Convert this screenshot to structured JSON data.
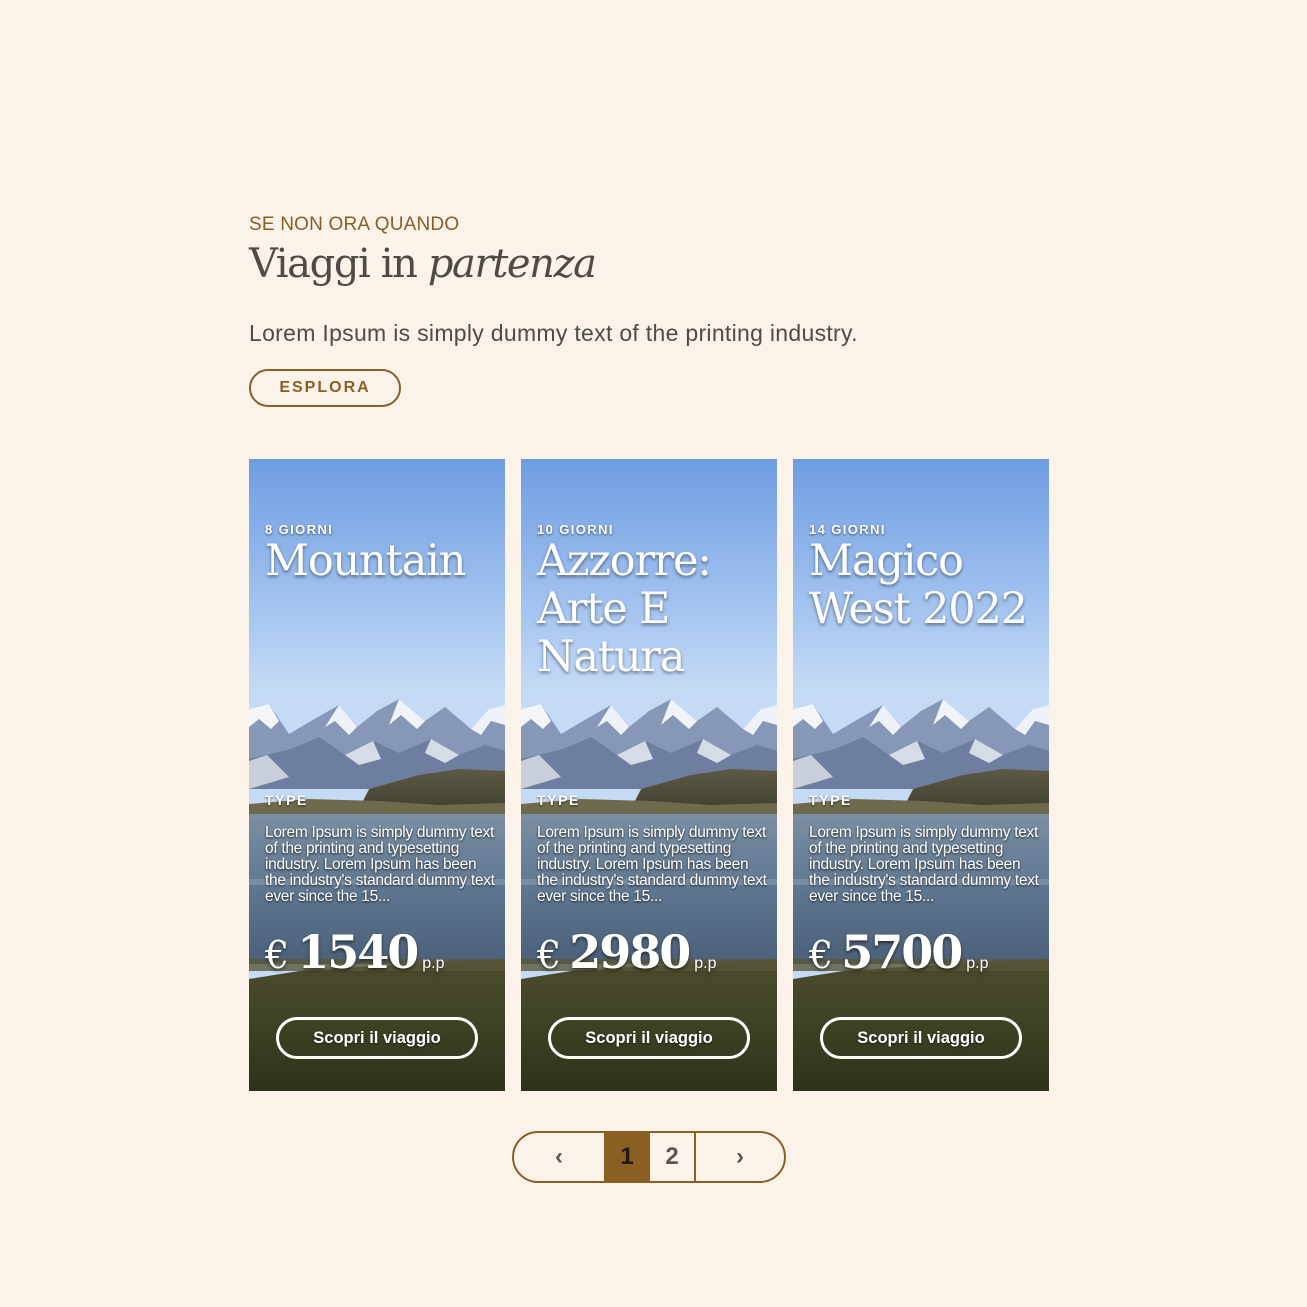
{
  "section": {
    "eyebrow": "SE NON ORA QUANDO",
    "title_plain": "Viaggi in ",
    "title_italic": "partenza",
    "lead": "Lorem Ipsum is simply dummy text of the printing industry.",
    "explore_label": "ESPLORA"
  },
  "cards": [
    {
      "days": "8 GIORNI",
      "name": "Mountain",
      "type": "TYPE",
      "description": "Lorem Ipsum is simply dummy text of the printing and typesetting industry. Lorem Ipsum has been the industry's standard dummy text ever since the 15...",
      "currency": "€",
      "price": "1540",
      "per_person": "p.p",
      "cta": "Scopri il viaggio"
    },
    {
      "days": "10 GIORNI",
      "name": "Azzorre: Arte E Natura",
      "type": "TYPE",
      "description": "Lorem Ipsum is simply dummy text of the printing and typesetting industry. Lorem Ipsum has been the industry's standard dummy text ever since the 15...",
      "currency": "€",
      "price": "2980",
      "per_person": "p.p",
      "cta": "Scopri il viaggio"
    },
    {
      "days": "14 GIORNI",
      "name": "Magico West 2022",
      "type": "TYPE",
      "description": "Lorem Ipsum is simply dummy text of the printing and typesetting industry. Lorem Ipsum has been the industry's standard dummy text ever since the 15...",
      "currency": "€",
      "price": "5700",
      "per_person": "p.p",
      "cta": "Scopri il viaggio"
    }
  ],
  "pagination": {
    "prev_icon": "‹",
    "pages": [
      "1",
      "2"
    ],
    "current_page": "1",
    "next_icon": "›"
  },
  "colors": {
    "background": "#fbf2ea",
    "accent": "#8a5f22",
    "text": "#4d4a47"
  }
}
